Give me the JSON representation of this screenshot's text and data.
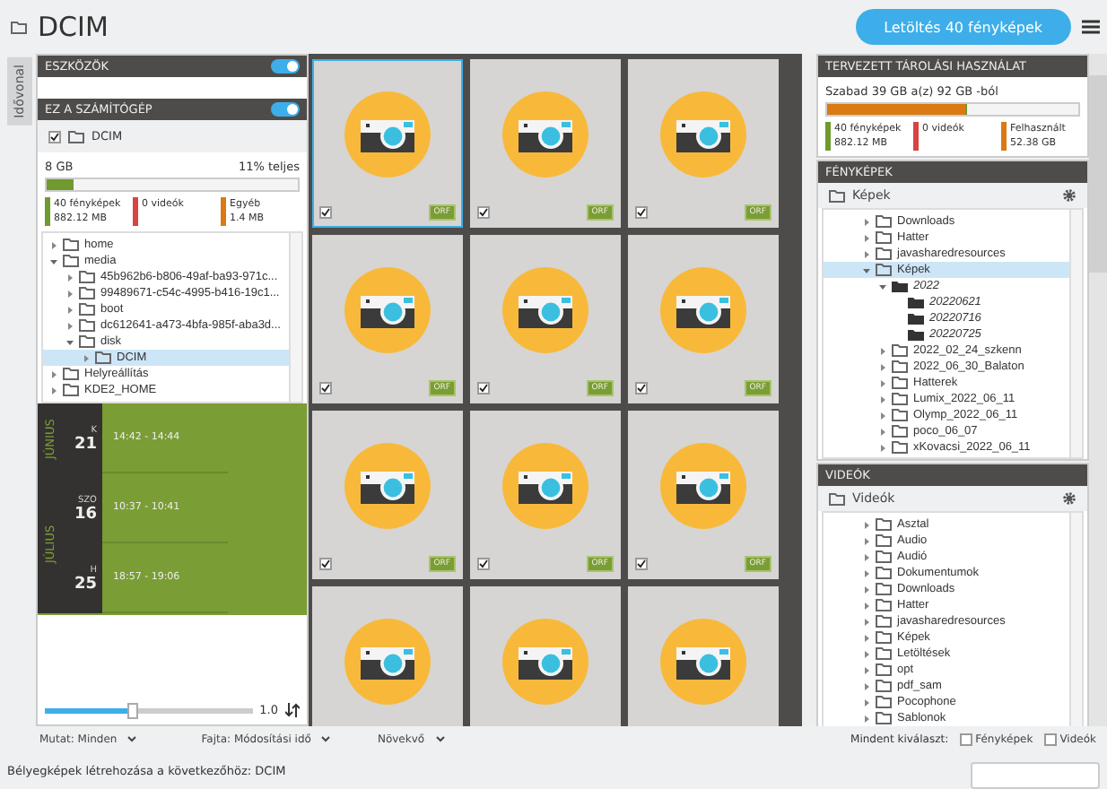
{
  "header": {
    "title": "DCIM",
    "download_button": "Letöltés 40 fényképek"
  },
  "left_tabs": [
    {
      "label": "Idővonal",
      "selected": true
    }
  ],
  "devices": {
    "title": "ESZKÖZÖK",
    "on": true
  },
  "computer": {
    "title": "EZ A SZÁMÍTÓGÉP",
    "on": true,
    "source": {
      "label": "DCIM",
      "checked": true
    },
    "capacity": "8 GB",
    "usage": "11% teljes",
    "bar": [
      {
        "level": 0.11,
        "color": "#6f9a2e"
      }
    ],
    "legend": [
      {
        "label": "40 fényképek",
        "value": "882.12 MB",
        "color": "#6f9a2e"
      },
      {
        "label": "0 videók",
        "color": "#d64541"
      },
      {
        "label": "Egyéb",
        "value": "1.4 MB",
        "color": "#d97a12"
      }
    ],
    "tree": [
      {
        "label": "home",
        "kind": "folder",
        "expanded": false,
        "selected": false
      },
      {
        "label": "media",
        "kind": "folder",
        "expanded": true,
        "selected": false,
        "children": [
          {
            "label": "45b962b6-b806-49af-ba93-971c...",
            "kind": "folder",
            "expanded": false,
            "selected": false
          },
          {
            "label": "99489671-c54c-4995-b416-19c1...",
            "kind": "folder",
            "expanded": false,
            "selected": false
          },
          {
            "label": "boot",
            "kind": "folder",
            "expanded": false,
            "selected": false
          },
          {
            "label": "dc612641-a473-4bfa-985f-aba3d...",
            "kind": "folder",
            "expanded": false,
            "selected": false
          },
          {
            "label": "disk",
            "kind": "folder",
            "expanded": true,
            "selected": false,
            "children": [
              {
                "label": "DCIM",
                "kind": "folder",
                "expanded": false,
                "selected": true
              }
            ]
          }
        ]
      },
      {
        "label": "Helyreállítás",
        "kind": "folder",
        "expanded": false,
        "selected": false
      },
      {
        "label": "KDE2_HOME",
        "kind": "folder",
        "expanded": false,
        "selected": false
      }
    ]
  },
  "timeline": [
    {
      "month": "JÚNIUS",
      "days": [
        {
          "weekday": "K",
          "day": "21",
          "time": "14:42 - 14:44"
        }
      ]
    },
    {
      "month": "JÚLIUS",
      "days": [
        {
          "weekday": "SZO",
          "day": "16",
          "time": "10:37 - 10:41"
        },
        {
          "weekday": "H",
          "day": "25",
          "time": "18:57 - 19:06"
        }
      ]
    }
  ],
  "zoom": {
    "level": 0.42,
    "value": "1.0"
  },
  "thumbnails": [
    {
      "badge": "ORF",
      "checked": true,
      "selected": true
    },
    {
      "badge": "ORF",
      "checked": true,
      "selected": false
    },
    {
      "badge": "ORF",
      "checked": true,
      "selected": false
    },
    {
      "badge": "ORF",
      "checked": true,
      "selected": false
    },
    {
      "badge": "ORF",
      "checked": true,
      "selected": false
    },
    {
      "badge": "ORF",
      "checked": true,
      "selected": false
    },
    {
      "badge": "ORF",
      "checked": true,
      "selected": false
    },
    {
      "badge": "ORF",
      "checked": true,
      "selected": false
    },
    {
      "badge": "ORF",
      "checked": true,
      "selected": false
    },
    {
      "selected": false
    },
    {
      "selected": false
    },
    {
      "selected": false
    }
  ],
  "storage": {
    "title": "TERVEZETT TÁROLÁSI HASZNÁLAT",
    "summary": "Szabad 39 GB  a(z)  92 GB -ból",
    "bar": [
      {
        "level": 0.55,
        "color": "#d97a12"
      },
      {
        "level": 0.01,
        "color": "#6f9a2e"
      }
    ],
    "legend": [
      {
        "label": "40 fényképek",
        "value": "882.12 MB",
        "color": "#6f9a2e"
      },
      {
        "label": "0 videók",
        "color": "#d64541"
      },
      {
        "label": "Felhasznált",
        "value": "52.38 GB",
        "color": "#d97a12"
      }
    ]
  },
  "photos": {
    "title": "FÉNYKÉPEK",
    "folder": "Képek",
    "tree": [
      {
        "label": "Downloads",
        "kind": "folder",
        "expanded": false,
        "selected": false
      },
      {
        "label": "Hatter",
        "kind": "folder",
        "expanded": false,
        "selected": false
      },
      {
        "label": "javasharedresources",
        "kind": "folder",
        "expanded": false,
        "selected": false
      },
      {
        "label": "Képek",
        "kind": "folder",
        "expanded": true,
        "selected": true,
        "children": [
          {
            "label": "2022",
            "kind": "new",
            "expanded": true,
            "selected": false,
            "children": [
              {
                "label": "20220621",
                "kind": "new",
                "selected": false
              },
              {
                "label": "20220716",
                "kind": "new",
                "selected": false
              },
              {
                "label": "20220725",
                "kind": "new",
                "selected": false
              }
            ]
          },
          {
            "label": "2022_02_24_szkenn",
            "kind": "folder",
            "expanded": false,
            "selected": false
          },
          {
            "label": "2022_06_30_Balaton",
            "kind": "folder",
            "expanded": false,
            "selected": false
          },
          {
            "label": "Hatterek",
            "kind": "folder",
            "expanded": false,
            "selected": false
          },
          {
            "label": "Lumix_2022_06_11",
            "kind": "folder",
            "expanded": false,
            "selected": false
          },
          {
            "label": "Olymp_2022_06_11",
            "kind": "folder",
            "expanded": false,
            "selected": false
          },
          {
            "label": "poco_06_07",
            "kind": "folder",
            "expanded": false,
            "selected": false
          },
          {
            "label": "xKovacsi_2022_06_11",
            "kind": "folder",
            "expanded": false,
            "selected": false
          }
        ]
      }
    ]
  },
  "videos": {
    "title": "VIDEÓK",
    "folder": "Videók",
    "tree": [
      {
        "label": "Asztal",
        "kind": "folder",
        "expanded": false,
        "selected": false
      },
      {
        "label": "Audio",
        "kind": "folder",
        "expanded": false,
        "selected": false
      },
      {
        "label": "Audió",
        "kind": "folder",
        "expanded": false,
        "selected": false
      },
      {
        "label": "Dokumentumok",
        "kind": "folder",
        "expanded": false,
        "selected": false
      },
      {
        "label": "Downloads",
        "kind": "folder",
        "expanded": false,
        "selected": false
      },
      {
        "label": "Hatter",
        "kind": "folder",
        "expanded": false,
        "selected": false
      },
      {
        "label": "javasharedresources",
        "kind": "folder",
        "expanded": false,
        "selected": false
      },
      {
        "label": "Képek",
        "kind": "folder",
        "expanded": false,
        "selected": false
      },
      {
        "label": "Letöltések",
        "kind": "folder",
        "expanded": false,
        "selected": false
      },
      {
        "label": "opt",
        "kind": "folder",
        "expanded": false,
        "selected": false
      },
      {
        "label": "pdf_sam",
        "kind": "folder",
        "expanded": false,
        "selected": false
      },
      {
        "label": "Pocophone",
        "kind": "folder",
        "expanded": false,
        "selected": false
      },
      {
        "label": "Sablonok",
        "kind": "folder",
        "expanded": false,
        "selected": false
      }
    ]
  },
  "toolbar": {
    "show_label": "Mutat:",
    "show_value": "Minden",
    "sort_label": "Fajta:",
    "sort_value": "Módosítási idő",
    "order": "Növekvő",
    "select_all_label": "Mindent kiválaszt:",
    "options": [
      {
        "label": "Fényképek",
        "checked": false
      },
      {
        "label": "Videók",
        "checked": false
      }
    ]
  },
  "status": "Bélyegképek létrehozása a következőhöz: DCIM"
}
